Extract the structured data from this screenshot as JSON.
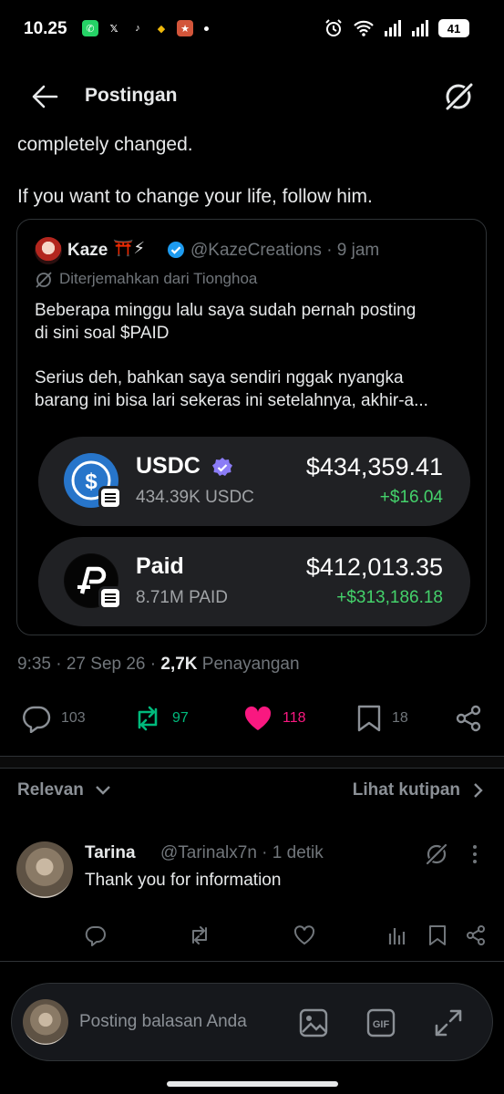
{
  "status_bar": {
    "time": "10.25",
    "battery": "41",
    "left_icons": [
      "whatsapp-icon",
      "x-icon",
      "tiktok-icon",
      "binance-icon",
      "game-icon"
    ],
    "right_icons": [
      "alarm-icon",
      "wifi-icon",
      "signal-icon",
      "signal-icon",
      "battery-icon"
    ]
  },
  "header": {
    "title": "Postingan"
  },
  "post": {
    "text_line1": "completely changed.",
    "text_line2": "If you want to change your life, follow him."
  },
  "quote": {
    "name": "Kaze",
    "emoji": "⛩️⚡",
    "handle_time": "@KazeCreations · 9 jam",
    "translated_label": "Diterjemahkan dari Tionghoa",
    "body_line1": "Beberapa minggu lalu saya sudah pernah posting",
    "body_line2": "di sini soal $PAID",
    "body_line3": "Serius deh, bahkan saya sendiri nggak nyangka",
    "body_line4": "barang ini bisa lari sekeras ini setelahnya, akhir-a...",
    "wallets": [
      {
        "name": "USDC",
        "amount": "434.39K USDC",
        "value": "$434,359.41",
        "change": "+$16.04"
      },
      {
        "name": "Paid",
        "amount": "8.71M PAID",
        "value": "$412,013.35",
        "change": "+$313,186.18"
      }
    ]
  },
  "meta": {
    "time_date": "9:35 · 27 Sep 26 · ",
    "views": "2,7K",
    "views_label": " Penayangan"
  },
  "actions": {
    "replies": "103",
    "reposts": "97",
    "likes": "118",
    "bookmarks": "18"
  },
  "filters": {
    "relevan": "Relevan",
    "lihat_kutipan": "Lihat kutipan"
  },
  "reply": {
    "name": "Tarina",
    "handle_time": "@Tarinalx7n · 1 detik",
    "text": "Thank you for information"
  },
  "composer": {
    "placeholder": "Posting balasan Anda"
  },
  "colors": {
    "background": "#000000",
    "text": "#e7e9ea",
    "muted": "#71767b",
    "repost_green": "#00ba7c",
    "like_pink": "#f91880",
    "verified_blue": "#1d9bf0",
    "gain_green": "#44d26b",
    "usdc_blue": "#2775ca"
  }
}
